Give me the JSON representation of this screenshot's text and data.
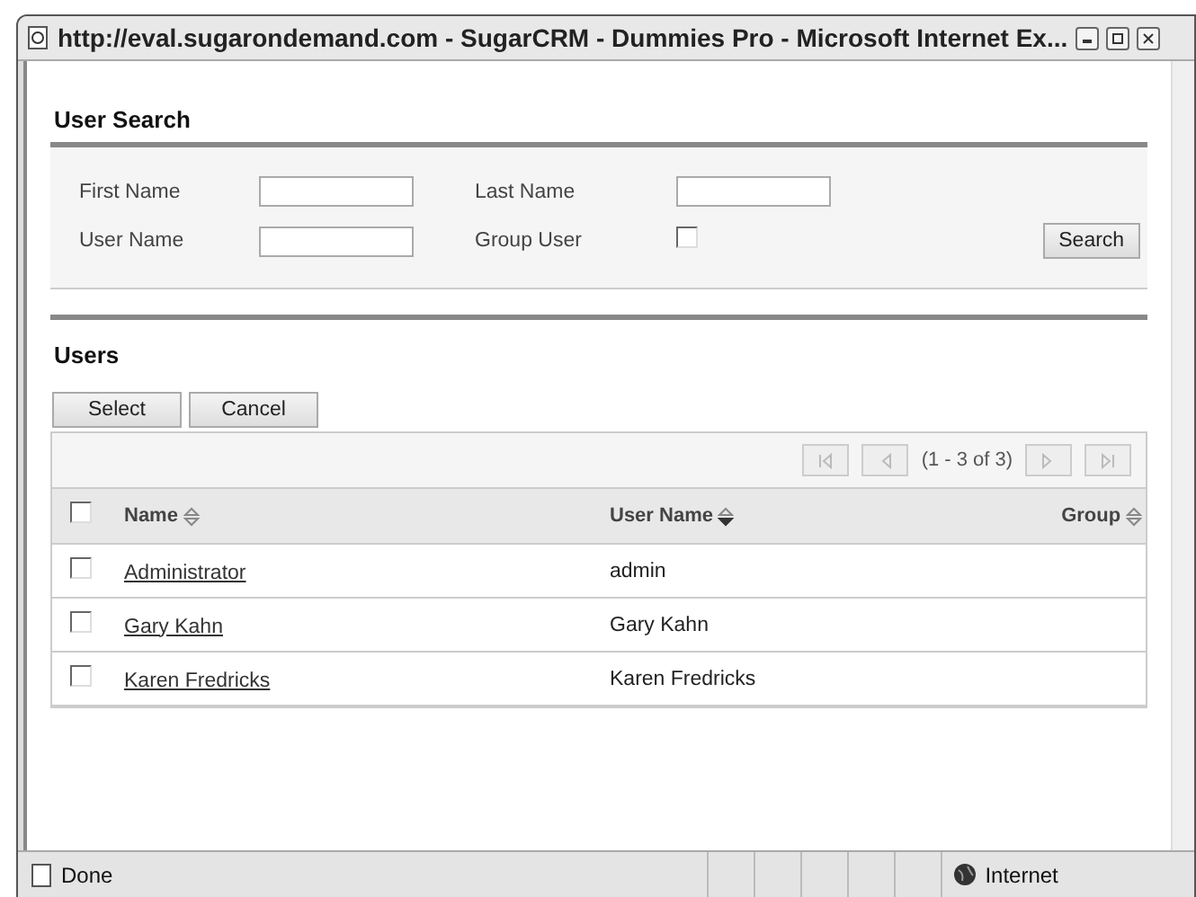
{
  "window": {
    "title": "http://eval.sugarondemand.com - SugarCRM - Dummies Pro - Microsoft Internet Ex..."
  },
  "search": {
    "title": "User Search",
    "fields": [
      {
        "label": "First Name",
        "kind": "text"
      },
      {
        "label": "Last Name",
        "kind": "text"
      },
      {
        "label": "User Name",
        "kind": "text"
      },
      {
        "label": "Group User",
        "kind": "checkbox",
        "checked": false
      }
    ],
    "button": "Search"
  },
  "users": {
    "title": "Users",
    "buttons": [
      "Select",
      "Cancel"
    ],
    "pager": "(1 - 3 of 3)",
    "select_all": {
      "checked": false
    },
    "columns": [
      {
        "label": "Name",
        "sorted": false
      },
      {
        "label": "User Name",
        "sorted": true
      },
      {
        "label": "Group",
        "sorted": false
      }
    ],
    "rows": [
      {
        "name": "Administrator",
        "user_name": "admin",
        "checked": false
      },
      {
        "name": "Gary Kahn",
        "user_name": "Gary Kahn",
        "checked": false
      },
      {
        "name": "Karen Fredricks",
        "user_name": "Karen Fredricks",
        "checked": false
      }
    ]
  },
  "status_bar": {
    "status": "Done",
    "zone": "Internet"
  }
}
